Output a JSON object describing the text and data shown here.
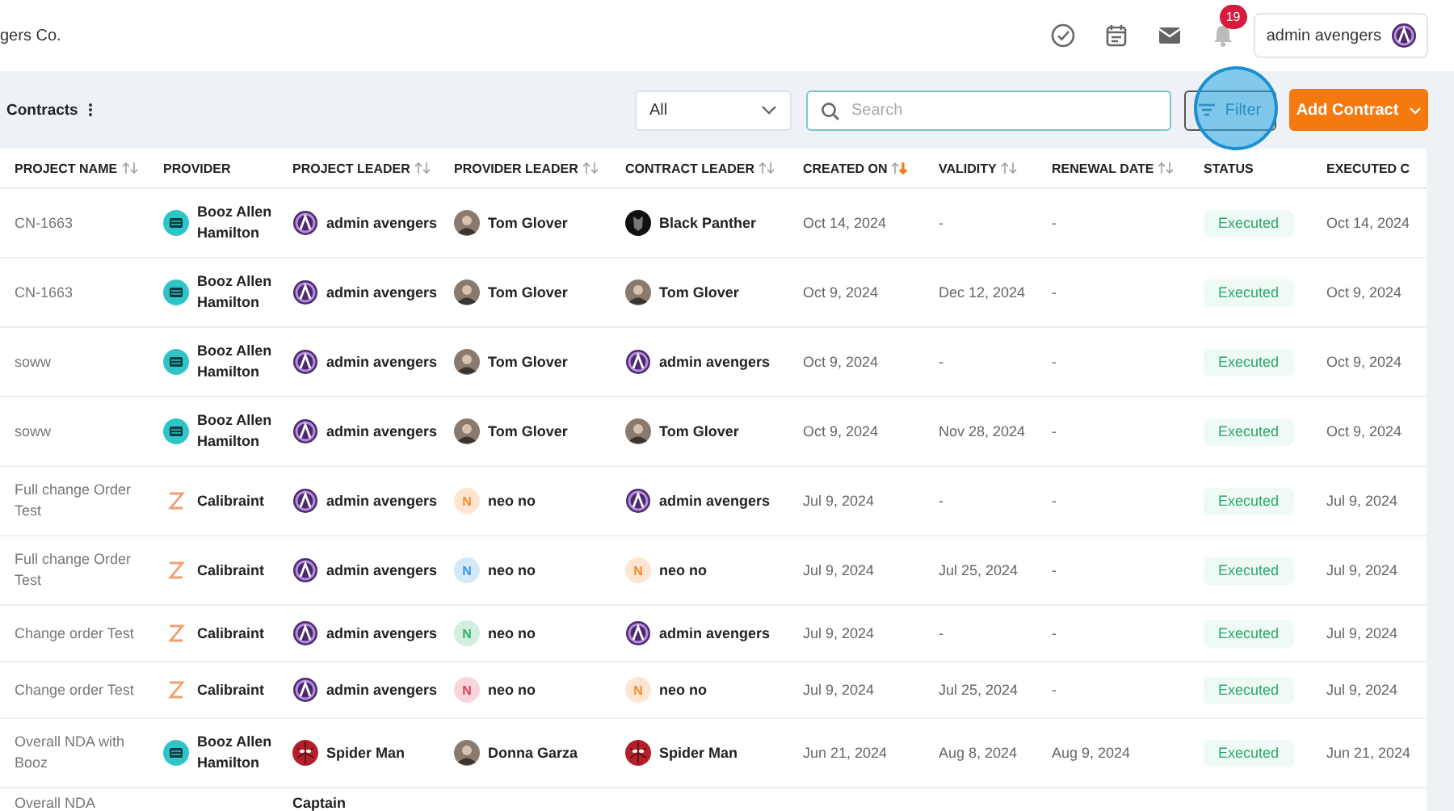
{
  "header": {
    "company": "gers Co.",
    "notifications": "19",
    "user": {
      "name": "admin avengers"
    }
  },
  "toolbar": {
    "title": "Contracts",
    "dropdown": {
      "value": "All"
    },
    "search": {
      "placeholder": "Search"
    },
    "filter": {
      "label": "Filter",
      "highlighted": true
    },
    "add_button": {
      "label": "Add Contract"
    }
  },
  "table": {
    "columns": [
      {
        "label": "PROJECT NAME",
        "kind": "sortable",
        "sorted_desc": false
      },
      {
        "label": "PROVIDER",
        "kind": "plain"
      },
      {
        "label": "PROJECT LEADER",
        "kind": "sortable",
        "sorted_desc": false
      },
      {
        "label": "PROVIDER LEADER",
        "kind": "sortable",
        "sorted_desc": false
      },
      {
        "label": "CONTRACT LEADER",
        "kind": "sortable",
        "sorted_desc": false
      },
      {
        "label": "CREATED ON",
        "kind": "sortable",
        "sorted_desc": true
      },
      {
        "label": "VALIDITY",
        "kind": "sortable",
        "sorted_desc": false
      },
      {
        "label": "RENEWAL DATE",
        "kind": "sortable",
        "sorted_desc": false
      },
      {
        "label": "STATUS",
        "kind": "plain"
      },
      {
        "label": "EXECUTED C",
        "kind": "plain"
      }
    ],
    "rows": [
      {
        "project": "CN-1663",
        "provider": {
          "name": "Booz Allen Hamilton",
          "kind": "booz"
        },
        "project_leader": {
          "name": "admin avengers",
          "avatar": {
            "kind": "emblem"
          }
        },
        "provider_leader": {
          "name": "Tom Glover",
          "avatar": {
            "kind": "person"
          }
        },
        "contract_leader": {
          "name": "Black Panther",
          "avatar": {
            "kind": "dark"
          }
        },
        "created_on": "Oct 14, 2024",
        "validity": "-",
        "renewal_date": "-",
        "status": {
          "label": "Executed",
          "kind": "executed"
        },
        "executed_on": "Oct 14, 2024"
      },
      {
        "project": "CN-1663",
        "provider": {
          "name": "Booz Allen Hamilton",
          "kind": "booz"
        },
        "project_leader": {
          "name": "admin avengers",
          "avatar": {
            "kind": "emblem"
          }
        },
        "provider_leader": {
          "name": "Tom Glover",
          "avatar": {
            "kind": "person"
          }
        },
        "contract_leader": {
          "name": "Tom Glover",
          "avatar": {
            "kind": "person"
          }
        },
        "created_on": "Oct 9, 2024",
        "validity": "Dec 12, 2024",
        "renewal_date": "-",
        "status": {
          "label": "Executed",
          "kind": "executed"
        },
        "executed_on": "Oct 9, 2024"
      },
      {
        "project": "soww",
        "provider": {
          "name": "Booz Allen Hamilton",
          "kind": "booz"
        },
        "project_leader": {
          "name": "admin avengers",
          "avatar": {
            "kind": "emblem"
          }
        },
        "provider_leader": {
          "name": "Tom Glover",
          "avatar": {
            "kind": "person"
          }
        },
        "contract_leader": {
          "name": "admin avengers",
          "avatar": {
            "kind": "emblem"
          }
        },
        "created_on": "Oct 9, 2024",
        "validity": "-",
        "renewal_date": "-",
        "status": {
          "label": "Executed",
          "kind": "executed"
        },
        "executed_on": "Oct 9, 2024"
      },
      {
        "project": "soww",
        "provider": {
          "name": "Booz Allen Hamilton",
          "kind": "booz"
        },
        "project_leader": {
          "name": "admin avengers",
          "avatar": {
            "kind": "emblem"
          }
        },
        "provider_leader": {
          "name": "Tom Glover",
          "avatar": {
            "kind": "person"
          }
        },
        "contract_leader": {
          "name": "Tom Glover",
          "avatar": {
            "kind": "person"
          }
        },
        "created_on": "Oct 9, 2024",
        "validity": "Nov 28, 2024",
        "renewal_date": "-",
        "status": {
          "label": "Executed",
          "kind": "executed"
        },
        "executed_on": "Oct 9, 2024"
      },
      {
        "project": "Full change Order Test",
        "provider": {
          "name": "Calibraint",
          "kind": "calibraint"
        },
        "project_leader": {
          "name": "admin avengers",
          "avatar": {
            "kind": "emblem"
          }
        },
        "provider_leader": {
          "name": "neo no",
          "avatar": {
            "kind": "initial",
            "letter": "N",
            "color": "#f08c2c"
          }
        },
        "contract_leader": {
          "name": "admin avengers",
          "avatar": {
            "kind": "emblem"
          }
        },
        "created_on": "Jul 9, 2024",
        "validity": "-",
        "renewal_date": "-",
        "status": {
          "label": "Executed",
          "kind": "executed"
        },
        "executed_on": "Jul 9, 2024"
      },
      {
        "project": "Full change Order Test",
        "provider": {
          "name": "Calibraint",
          "kind": "calibraint"
        },
        "project_leader": {
          "name": "admin avengers",
          "avatar": {
            "kind": "emblem"
          }
        },
        "provider_leader": {
          "name": "neo no",
          "avatar": {
            "kind": "initial",
            "letter": "N",
            "color": "#3b9be0"
          }
        },
        "contract_leader": {
          "name": "neo no",
          "avatar": {
            "kind": "initial",
            "letter": "N",
            "color": "#f08c2c"
          }
        },
        "created_on": "Jul 9, 2024",
        "validity": "Jul 25, 2024",
        "renewal_date": "-",
        "status": {
          "label": "Executed",
          "kind": "executed"
        },
        "executed_on": "Jul 9, 2024"
      },
      {
        "project": "Change order Test",
        "provider": {
          "name": "Calibraint",
          "kind": "calibraint"
        },
        "project_leader": {
          "name": "admin avengers",
          "avatar": {
            "kind": "emblem"
          }
        },
        "provider_leader": {
          "name": "neo no",
          "avatar": {
            "kind": "initial",
            "letter": "N",
            "color": "#2fb36a"
          }
        },
        "contract_leader": {
          "name": "admin avengers",
          "avatar": {
            "kind": "emblem"
          }
        },
        "created_on": "Jul 9, 2024",
        "validity": "-",
        "renewal_date": "-",
        "status": {
          "label": "Executed",
          "kind": "executed"
        },
        "executed_on": "Jul 9, 2024"
      },
      {
        "project": "Change order Test",
        "provider": {
          "name": "Calibraint",
          "kind": "calibraint"
        },
        "project_leader": {
          "name": "admin avengers",
          "avatar": {
            "kind": "emblem"
          }
        },
        "provider_leader": {
          "name": "neo no",
          "avatar": {
            "kind": "initial",
            "letter": "N",
            "color": "#e0405a"
          }
        },
        "contract_leader": {
          "name": "neo no",
          "avatar": {
            "kind": "initial",
            "letter": "N",
            "color": "#f08c2c"
          }
        },
        "created_on": "Jul 9, 2024",
        "validity": "Jul 25, 2024",
        "renewal_date": "-",
        "status": {
          "label": "Executed",
          "kind": "executed"
        },
        "executed_on": "Jul 9, 2024"
      },
      {
        "project": "Overall NDA with Booz",
        "provider": {
          "name": "Booz Allen Hamilton",
          "kind": "booz"
        },
        "project_leader": {
          "name": "Spider Man",
          "avatar": {
            "kind": "red"
          }
        },
        "provider_leader": {
          "name": "Donna Garza",
          "avatar": {
            "kind": "person"
          }
        },
        "contract_leader": {
          "name": "Spider Man",
          "avatar": {
            "kind": "red"
          }
        },
        "created_on": "Jun 21, 2024",
        "validity": "Aug 8, 2024",
        "renewal_date": "Aug 9, 2024",
        "status": {
          "label": "Executed",
          "kind": "executed"
        },
        "executed_on": "Jun 21, 2024"
      }
    ],
    "partial_row": {
      "project": "Overall NDA",
      "project_leader": "Captain"
    }
  }
}
